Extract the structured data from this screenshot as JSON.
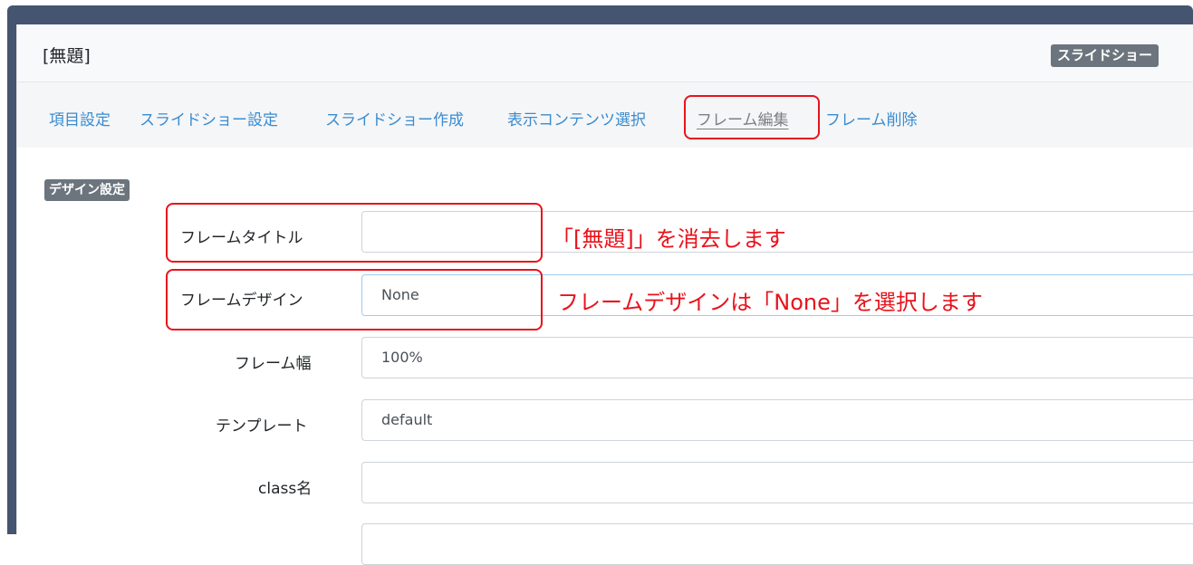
{
  "frame": {
    "title": "[無題]",
    "plugin_badge": "スライドショー"
  },
  "edit_nav": {
    "items": [
      {
        "label": "項目設定"
      },
      {
        "label": "スライドショー設定"
      },
      {
        "label": "スライドショー作成"
      },
      {
        "label": "表示コンテンツ選択"
      },
      {
        "label": "フレーム編集",
        "active": true
      },
      {
        "label": "フレーム削除"
      }
    ]
  },
  "design_settings": {
    "section_label": "デザイン設定",
    "fields": {
      "frame_title": {
        "label": "フレームタイトル",
        "value": ""
      },
      "frame_design": {
        "label": "フレームデザイン",
        "value": "None"
      },
      "frame_width": {
        "label": "フレーム幅",
        "value": "100%"
      },
      "template": {
        "label": "テンプレート",
        "value": "default"
      },
      "class_name": {
        "label": "class名",
        "value": ""
      }
    }
  },
  "annotations": {
    "title_note": "「[無題]」を消去します",
    "design_note": "フレームデザインは「None」を選択します"
  },
  "colors": {
    "header_band": "#455570",
    "highlight": "#e8131b",
    "link": "#3a8cd0",
    "badge": "#6c757d"
  }
}
